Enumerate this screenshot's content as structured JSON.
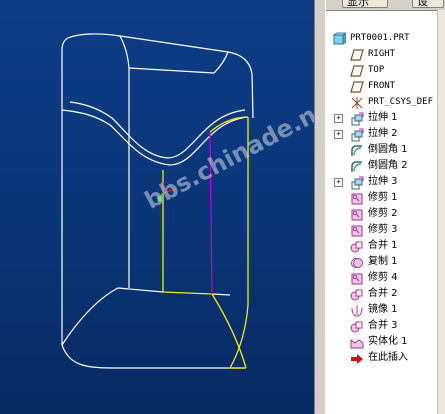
{
  "toolbar": {
    "left_button": "显示",
    "right_button": "设"
  },
  "watermark": "bbs.chinade.net",
  "tree": [
    {
      "label": "PRT0001.PRT",
      "icon": "part-icon",
      "level": 0,
      "expander": false
    },
    {
      "label": "RIGHT",
      "icon": "datum-plane-icon",
      "level": 1,
      "expander": false
    },
    {
      "label": "TOP",
      "icon": "datum-plane-icon",
      "level": 1,
      "expander": false
    },
    {
      "label": "FRONT",
      "icon": "datum-plane-icon",
      "level": 1,
      "expander": false
    },
    {
      "label": "PRT_CSYS_DEF",
      "icon": "csys-icon",
      "level": 1,
      "expander": false
    },
    {
      "label": "拉伸 1",
      "icon": "extrude-icon",
      "level": 1,
      "expander": true
    },
    {
      "label": "拉伸 2",
      "icon": "extrude-icon",
      "level": 1,
      "expander": true
    },
    {
      "label": "倒圆角 1",
      "icon": "round-icon",
      "level": 1,
      "expander": false
    },
    {
      "label": "倒圆角 2",
      "icon": "round-icon",
      "level": 1,
      "expander": false
    },
    {
      "label": "拉伸 3",
      "icon": "extrude-icon",
      "level": 1,
      "expander": true
    },
    {
      "label": "修剪 1",
      "icon": "trim-icon",
      "level": 1,
      "expander": false
    },
    {
      "label": "修剪 2",
      "icon": "trim-icon",
      "level": 1,
      "expander": false
    },
    {
      "label": "修剪 3",
      "icon": "trim-icon",
      "level": 1,
      "expander": false
    },
    {
      "label": "合并 1",
      "icon": "merge-icon",
      "level": 1,
      "expander": false
    },
    {
      "label": "复制 1",
      "icon": "copy-icon",
      "level": 1,
      "expander": false
    },
    {
      "label": "修剪 4",
      "icon": "trim-icon",
      "level": 1,
      "expander": false
    },
    {
      "label": "合并 2",
      "icon": "merge-icon",
      "level": 1,
      "expander": false
    },
    {
      "label": "镜像 1",
      "icon": "mirror-icon",
      "level": 1,
      "expander": false
    },
    {
      "label": "合并 3",
      "icon": "merge-icon",
      "level": 1,
      "expander": false
    },
    {
      "label": "实体化 1",
      "icon": "solidify-icon",
      "level": 1,
      "expander": false
    },
    {
      "label": "在此插入",
      "icon": "insert-here-icon",
      "level": 1,
      "expander": false
    }
  ],
  "colors": {
    "viewport_bg": "#0a3577",
    "edge_white": "#ffffff",
    "edge_yellow": "#f0f000",
    "edge_magenta": "#c000e0",
    "icon_accent": "#b03090",
    "insert_arrow": "#d01010"
  }
}
